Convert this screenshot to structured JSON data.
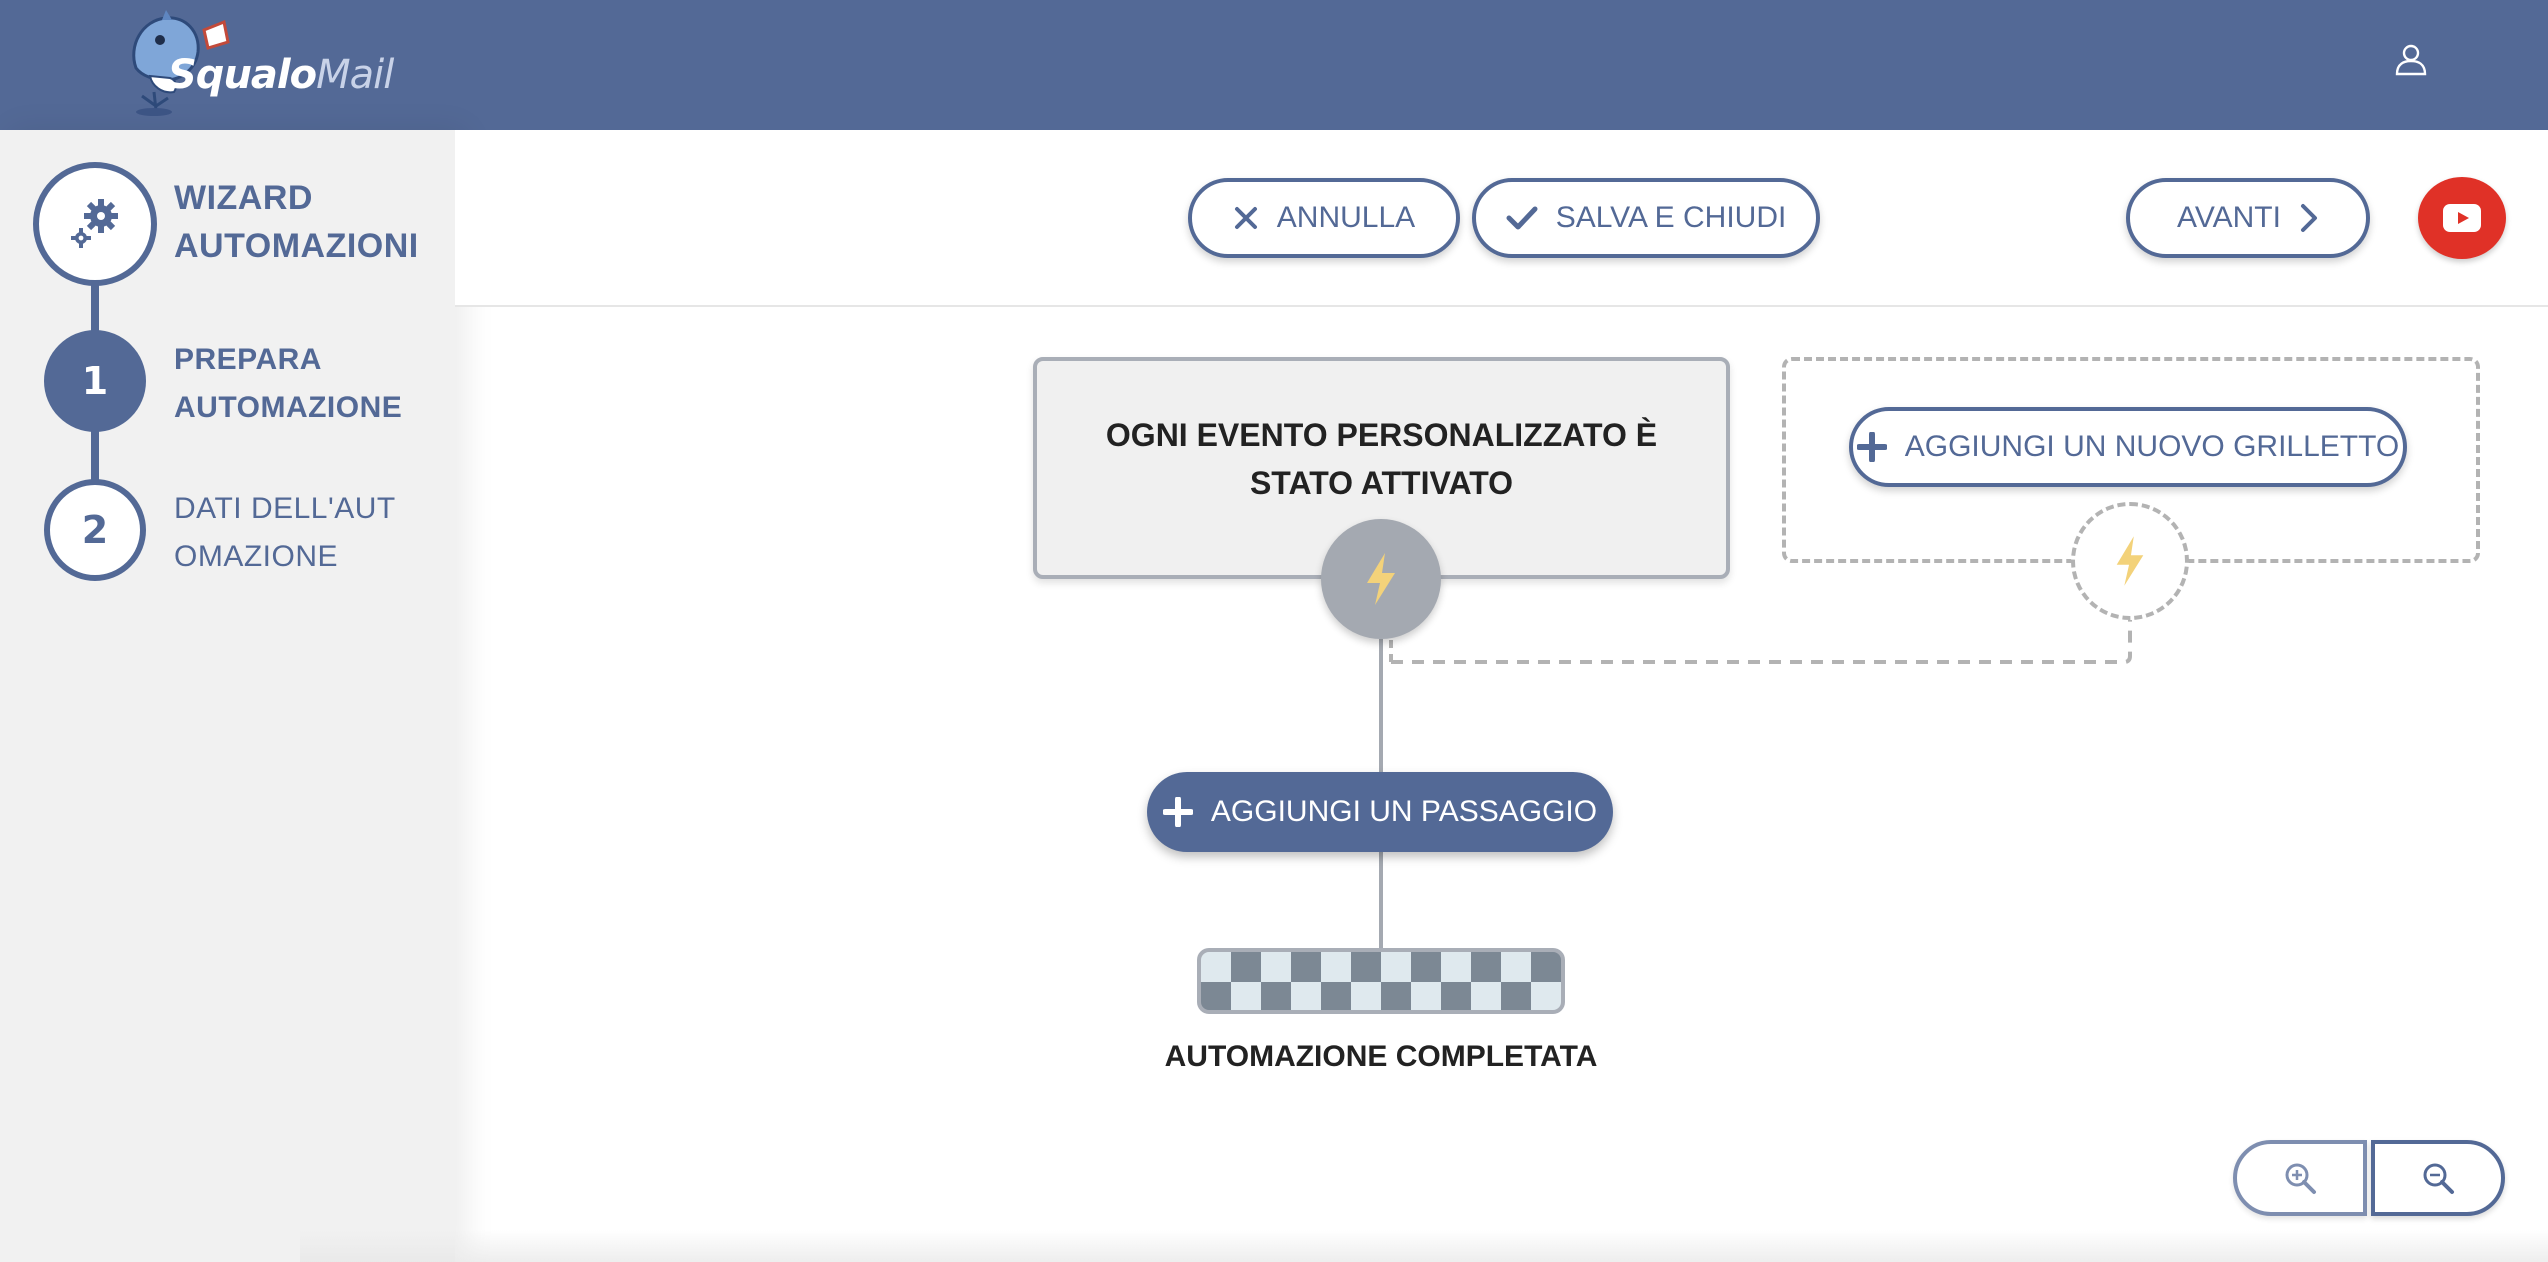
{
  "app": {
    "logo_main": "Squalo",
    "logo_sub": "Mail"
  },
  "header": {
    "user_icon": "user-icon"
  },
  "sidebar": {
    "wizard_title": "WIZARD AUTOMAZIONI",
    "steps": [
      {
        "number": "1",
        "label": "PREPARA AUTOMAZIONE",
        "active": true
      },
      {
        "number": "2",
        "label": "DATI DELL'AUTOMAZIONE",
        "active": false
      }
    ]
  },
  "toolbar": {
    "cancel_label": "ANNULLA",
    "save_close_label": "SALVA E CHIUDI",
    "next_label": "AVANTI"
  },
  "canvas": {
    "trigger_title": "OGNI EVENTO PERSONALIZZATO È STATO ATTIVATO",
    "new_trigger_label": "AGGIUNGI UN NUOVO GRILLETTO",
    "add_step_label": "AGGIUNGI UN PASSAGGIO",
    "finish_label": "AUTOMAZIONE COMPLETATA"
  },
  "colors": {
    "brand": "#536996",
    "youtube": "#e03127",
    "bolt": "#f3d27a"
  }
}
